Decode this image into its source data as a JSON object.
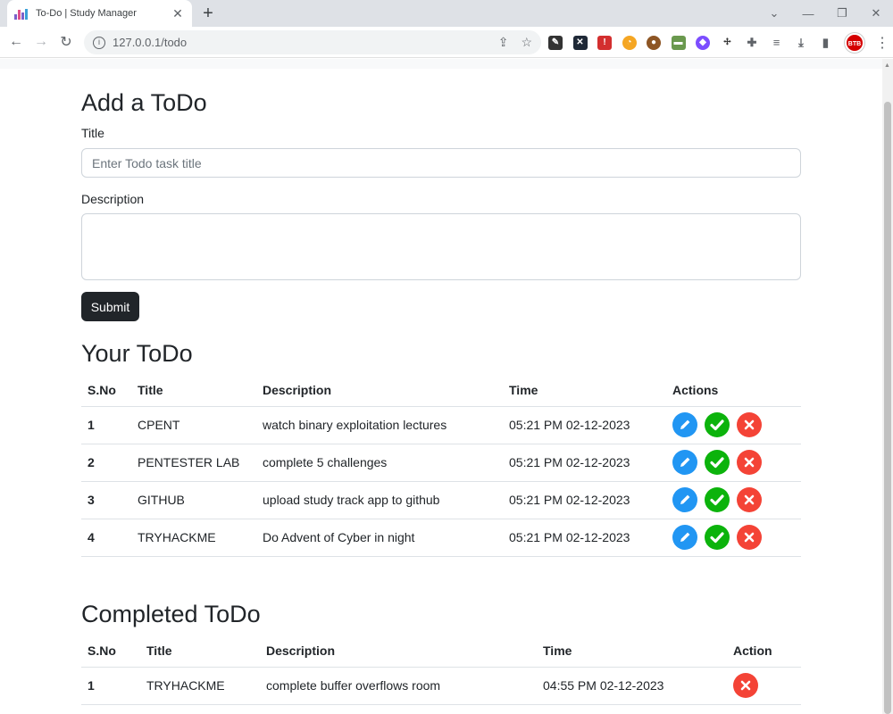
{
  "browser": {
    "tab_title": "To-Do | Study Manager",
    "url": "127.0.0.1/todo",
    "profile_label": "BTB"
  },
  "form": {
    "heading": "Add a ToDo",
    "title_label": "Title",
    "title_placeholder": "Enter Todo task title",
    "title_value": "",
    "description_label": "Description",
    "description_value": "",
    "submit_label": "Submit"
  },
  "todo": {
    "heading": "Your ToDo",
    "columns": [
      "S.No",
      "Title",
      "Description",
      "Time",
      "Actions"
    ],
    "rows": [
      {
        "sno": "1",
        "title": "CPENT",
        "description": "watch binary exploitation lectures",
        "time": "05:21 PM 02-12-2023"
      },
      {
        "sno": "2",
        "title": "PENTESTER LAB",
        "description": "complete 5 challenges",
        "time": "05:21 PM 02-12-2023"
      },
      {
        "sno": "3",
        "title": "GITHUB",
        "description": "upload study track app to github",
        "time": "05:21 PM 02-12-2023"
      },
      {
        "sno": "4",
        "title": "TRYHACKME",
        "description": "Do Advent of Cyber in night",
        "time": "05:21 PM 02-12-2023"
      }
    ]
  },
  "completed": {
    "heading": "Completed ToDo",
    "columns": [
      "S.No",
      "Title",
      "Description",
      "Time",
      "Action"
    ],
    "rows": [
      {
        "sno": "1",
        "title": "TRYHACKME",
        "description": "complete buffer overflows room",
        "time": "04:55 PM 02-12-2023"
      }
    ]
  },
  "colors": {
    "edit": "#2196f3",
    "complete": "#0cb30c",
    "delete": "#f44336",
    "submit": "#212529"
  },
  "icons": {
    "edit": "pencil-icon",
    "complete": "check-icon",
    "delete": "x-icon"
  }
}
